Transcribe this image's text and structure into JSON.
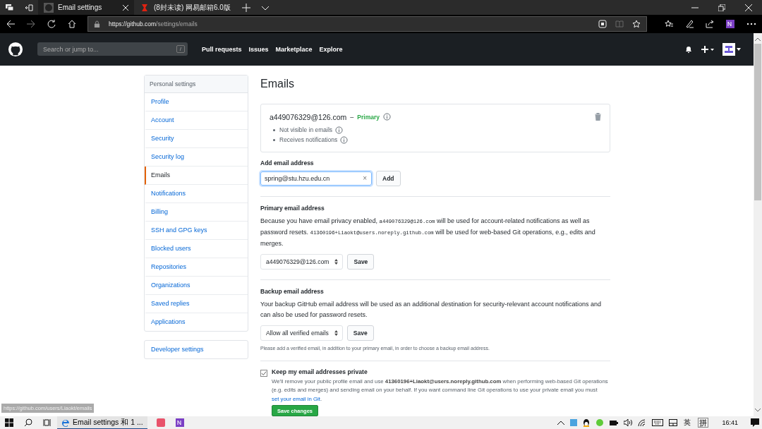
{
  "browser": {
    "tabs": [
      {
        "title": "Email settings",
        "selected": true
      },
      {
        "title": "(8封未读) 网易邮箱6.0版",
        "selected": false
      }
    ],
    "url": {
      "host": "https://github.com",
      "path": "/settings/emails"
    },
    "status_url": "https://github.com/users/Liaokt/emails"
  },
  "header": {
    "search_placeholder": "Search or jump to...",
    "search_key": "/",
    "nav": [
      "Pull requests",
      "Issues",
      "Marketplace",
      "Explore"
    ]
  },
  "sidebar": {
    "title": "Personal settings",
    "items": [
      {
        "label": "Profile",
        "selected": false
      },
      {
        "label": "Account",
        "selected": false
      },
      {
        "label": "Security",
        "selected": false
      },
      {
        "label": "Security log",
        "selected": false
      },
      {
        "label": "Emails",
        "selected": true
      },
      {
        "label": "Notifications",
        "selected": false
      },
      {
        "label": "Billing",
        "selected": false
      },
      {
        "label": "SSH and GPG keys",
        "selected": false
      },
      {
        "label": "Blocked users",
        "selected": false
      },
      {
        "label": "Repositories",
        "selected": false
      },
      {
        "label": "Organizations",
        "selected": false
      },
      {
        "label": "Saved replies",
        "selected": false
      },
      {
        "label": "Applications",
        "selected": false
      }
    ],
    "developer": "Developer settings"
  },
  "page_title": "Emails",
  "email_card": {
    "address": "a449076329@126.com",
    "separator": "–",
    "badge": "Primary",
    "notes": [
      "Not visible in emails",
      "Receives notifications"
    ]
  },
  "add_email": {
    "label": "Add email address",
    "value": "spring@stu.hzu.edu.cn",
    "clear": "×",
    "button": "Add"
  },
  "primary": {
    "heading": "Primary email address",
    "text": [
      {
        "kind": "text",
        "t": "Because you have email privacy enabled, "
      },
      {
        "kind": "code",
        "t": "a449076329@126.com"
      },
      {
        "kind": "text",
        "t": " will be used for account-related notifications as well as password resets. "
      },
      {
        "kind": "code",
        "t": "41360196+Liaokt@users.noreply.github.com"
      },
      {
        "kind": "text",
        "t": " will be used for web-based Git operations, e.g., edits and merges."
      }
    ],
    "select": "a449076329@126.com",
    "button": "Save"
  },
  "backup": {
    "heading": "Backup email address",
    "text": "Your backup GitHub email address will be used as an additional destination for security-relevant account notifications and can also be used for password resets.",
    "select": "Allow all verified emails",
    "button": "Save",
    "note": "Please add a verified email, in addition to your primary email, in order to choose a backup email address."
  },
  "private": {
    "checked": true,
    "label": "Keep my email addresses private",
    "text": [
      {
        "kind": "text",
        "t": "We'll remove your public profile email and use "
      },
      {
        "kind": "bold",
        "t": "41360196+Liaokt@users.noreply.github.com"
      },
      {
        "kind": "text",
        "t": " when performing web-based Git operations (e.g. edits and merges) and sending email on your behalf. If you want command line Git operations to use your private email you must "
      },
      {
        "kind": "link",
        "t": "set your email in Git"
      },
      {
        "kind": "text",
        "t": "."
      }
    ],
    "button": "Save changes"
  },
  "taskbar": {
    "app": "Email settings 和 1 ...",
    "lang": "英",
    "ime": "拼",
    "time": "16:41"
  }
}
